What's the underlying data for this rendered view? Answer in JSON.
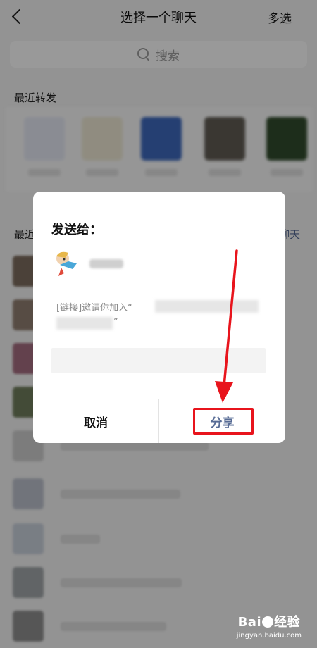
{
  "header": {
    "back_icon": "chevron-left-icon",
    "title": "选择一个聊天",
    "multi_select_label": "多选"
  },
  "search": {
    "icon": "search-icon",
    "placeholder": "搜索"
  },
  "recent_forward": {
    "label": "最近转发"
  },
  "recent_chats": {
    "label": "最近",
    "new_chat_label": "聊天"
  },
  "dialog": {
    "title": "发送给：",
    "link_prefix": "[链接]邀请你加入“",
    "link_suffix": "”",
    "cancel_label": "取消",
    "share_label": "分享"
  },
  "colors": {
    "accent": "#576b95",
    "annotation": "#e8141c"
  },
  "watermark": {
    "brand": "Bai",
    "brand_suffix": "经验",
    "url": "jingyan.baidu.com"
  }
}
